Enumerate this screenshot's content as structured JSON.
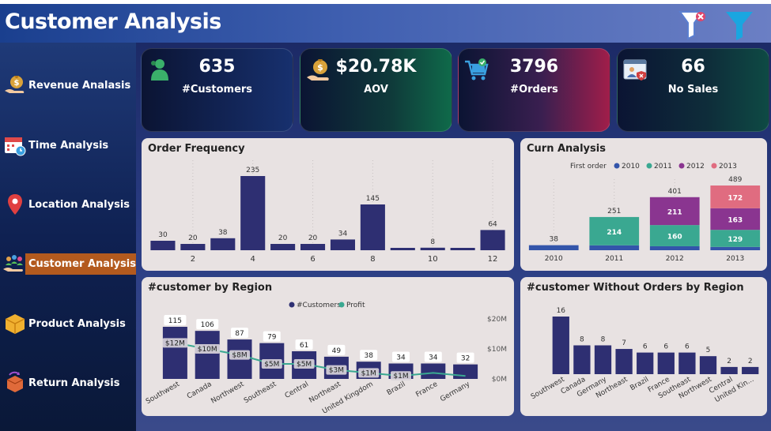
{
  "header": {
    "title": "Customer Analysis"
  },
  "sidebar": {
    "items": [
      {
        "label": "Revenue Analasis",
        "icon": "money-bag-hand-icon"
      },
      {
        "label": "Time Analysis",
        "icon": "calendar-clock-icon"
      },
      {
        "label": "Location Analysis",
        "icon": "location-pin-icon"
      },
      {
        "label": "Customer Analysis",
        "icon": "customers-hand-icon",
        "active": true
      },
      {
        "label": "Product Analysis",
        "icon": "product-box-icon"
      },
      {
        "label": "Return Analysis",
        "icon": "return-box-icon"
      }
    ],
    "active_color": "#b35a1e"
  },
  "kpis": [
    {
      "value": "635",
      "label": "#Customers",
      "icon": "customer-person-icon"
    },
    {
      "value": "$20.78K",
      "label": "AOV",
      "icon": "money-bag-icon"
    },
    {
      "value": "3796",
      "label": "#Orders",
      "icon": "shopping-cart-icon"
    },
    {
      "value": "66",
      "label": "No Sales",
      "icon": "no-sales-window-icon"
    }
  ],
  "chart_data": [
    {
      "id": "order_frequency",
      "type": "bar",
      "title": "Order Frequency",
      "categories": [
        "1",
        "2",
        "3",
        "4",
        "5",
        "6",
        "7",
        "8",
        "9",
        "10",
        "11",
        "12"
      ],
      "x_tick_labels": [
        "2",
        "4",
        "6",
        "8",
        "10",
        "12"
      ],
      "values": [
        30,
        20,
        38,
        235,
        20,
        20,
        34,
        145,
        null,
        8,
        null,
        64
      ],
      "bar_color": "#2e2f72"
    },
    {
      "id": "curn_analysis",
      "type": "bar",
      "title": "Curn Analysis",
      "legend_title": "First order",
      "categories": [
        "2010",
        "2011",
        "2012",
        "2013"
      ],
      "series": [
        {
          "name": "2010",
          "color": "#3355aa",
          "values": [
            38,
            37,
            30,
            25
          ]
        },
        {
          "name": "2011",
          "color": "#3aa891",
          "values": [
            null,
            214,
            160,
            129
          ]
        },
        {
          "name": "2012",
          "color": "#8a3590",
          "values": [
            null,
            null,
            211,
            163
          ]
        },
        {
          "name": "2013",
          "color": "#e06c80",
          "values": [
            null,
            null,
            null,
            172
          ]
        }
      ],
      "totals": [
        38,
        251,
        401,
        489
      ]
    },
    {
      "id": "customer_by_region",
      "type": "bar",
      "title": "#customer by Region",
      "legend": [
        "#Customers",
        "Profit"
      ],
      "categories": [
        "Southwest",
        "Canada",
        "Northwest",
        "Southeast",
        "Central",
        "Northeast",
        "United Kingdom",
        "Brazil",
        "France",
        "Germany"
      ],
      "customers": [
        115,
        106,
        87,
        79,
        61,
        49,
        38,
        34,
        34,
        32
      ],
      "profit_labels": [
        "$12M",
        "$10M",
        "$8M",
        "$5M",
        "$5M",
        "$3M",
        "$1M",
        "$1M"
      ],
      "profit_values": [
        12,
        10,
        8,
        5,
        5,
        3,
        2,
        1,
        2,
        1
      ],
      "y2_ticks": [
        "$20M",
        "$10M",
        "$0M"
      ],
      "bar_color": "#2e2f72",
      "line_color": "#3aa891"
    },
    {
      "id": "customer_without_orders_by_region",
      "type": "bar",
      "title": "#customer Without Orders by Region",
      "categories": [
        "Southwest",
        "Canada",
        "Germany",
        "Northeast",
        "Brazil",
        "France",
        "Southeast",
        "Northwest",
        "Central",
        "United Kin..."
      ],
      "values": [
        16,
        8,
        8,
        7,
        6,
        6,
        6,
        5,
        2,
        2
      ],
      "bar_color": "#2e2f72"
    }
  ]
}
